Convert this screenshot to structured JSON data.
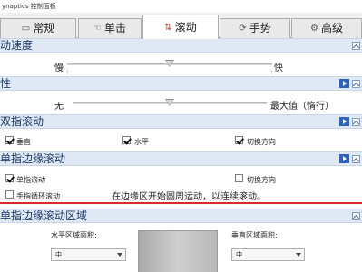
{
  "window": {
    "title": "ynaptics 控制面板"
  },
  "tabs": [
    {
      "label": "常规",
      "icon": "monitor-icon",
      "active": false
    },
    {
      "label": "单击",
      "icon": "click-icon",
      "active": false
    },
    {
      "label": "滚动",
      "icon": "scroll-icon",
      "active": true
    },
    {
      "label": "手势",
      "icon": "gesture-icon",
      "active": false
    },
    {
      "label": "高级",
      "icon": "gear-icon",
      "active": false
    }
  ],
  "scroll_speed": {
    "header": "动速度",
    "min_label": "慢",
    "max_label": "快",
    "value_fraction": 0.5
  },
  "inertia": {
    "header": "性",
    "min_label": "无",
    "max_label": "最大值（惰行）",
    "value_fraction": 0.5
  },
  "two_finger": {
    "header": "双指滚动",
    "options": [
      {
        "label": "垂直",
        "checked": true
      },
      {
        "label": "水平",
        "checked": true
      },
      {
        "label": "切换方向",
        "checked": true
      }
    ]
  },
  "edge_scroll": {
    "header": "单指边缘滚动",
    "options": [
      {
        "label": "单指滚动",
        "checked": true
      },
      {
        "label": "切换方向",
        "checked": false
      },
      {
        "label": "手指循环滚动",
        "checked": false
      }
    ],
    "hint": "在边缘区开始圆周运动，以连续滚动。"
  },
  "edge_region": {
    "header": "单指边缘滚动区域",
    "horizontal_label": "水平区域面积:",
    "horizontal_value": "中",
    "vertical_label": "垂直区域面积:",
    "vertical_value": "中"
  },
  "colors": {
    "accent_red": "#d42a2a",
    "section_bg": "#dfe8f3",
    "header_text": "#1e3d6e"
  }
}
